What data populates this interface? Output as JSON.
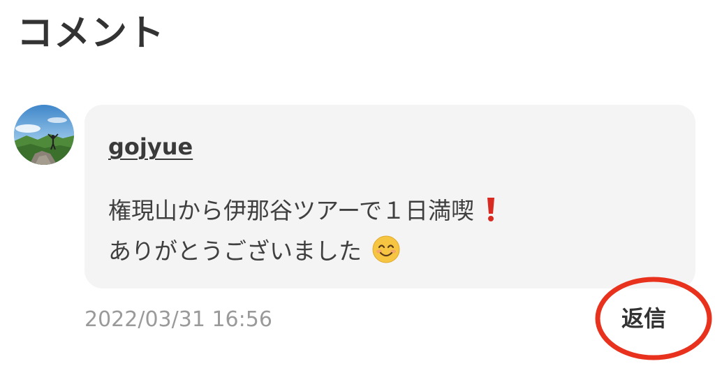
{
  "section": {
    "title": "コメント"
  },
  "comment": {
    "author": "gojyue",
    "body_line1": "権現山から伊那谷ツアーで１日満喫",
    "body_line2": "ありがとうございました",
    "emoji_line1": "red-exclamation-icon",
    "emoji_line2": "smiling-face-icon",
    "timestamp": "2022/03/31 16:56",
    "reply_label": "返信"
  },
  "annotation": {
    "highlight_color": "#e8321e"
  }
}
